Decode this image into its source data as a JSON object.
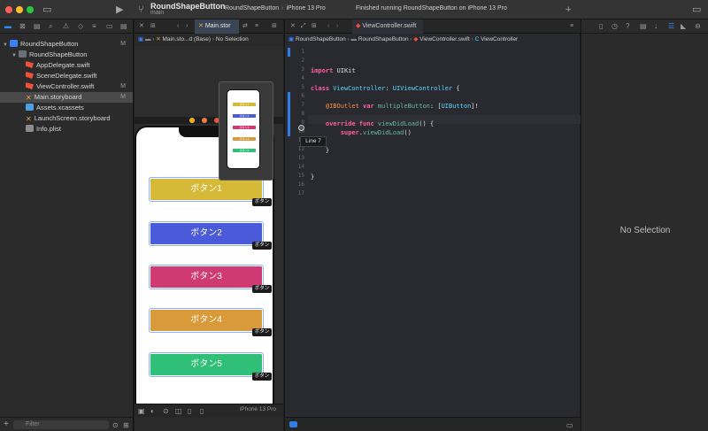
{
  "window": {
    "project_title": "RoundShapeButton",
    "branch": "main",
    "scheme": "RoundShapeButton",
    "device": "iPhone 13 Pro",
    "status": "Finished running RoundShapeButton on iPhone 13 Pro"
  },
  "navigator": {
    "items": [
      {
        "label": "RoundShapeButton",
        "mark": "M"
      },
      {
        "label": "RoundShapeButton",
        "mark": ""
      },
      {
        "label": "AppDelegate.swift",
        "mark": ""
      },
      {
        "label": "SceneDelegate.swift",
        "mark": ""
      },
      {
        "label": "ViewController.swift",
        "mark": "M"
      },
      {
        "label": "Main.storyboard",
        "mark": "M"
      },
      {
        "label": "Assets.xcassets",
        "mark": ""
      },
      {
        "label": "LaunchScreen.storyboard",
        "mark": ""
      },
      {
        "label": "Info.plist",
        "mark": ""
      }
    ],
    "filter_placeholder": "Filter"
  },
  "storyboard_editor": {
    "tab_label": "Main.stor",
    "breadcrumb": [
      "Main.sto...d (Base)",
      "No Selection"
    ],
    "buttons": [
      {
        "label": "ボタン1",
        "color": "#d6b937"
      },
      {
        "label": "ボタン2",
        "color": "#4a5ad9"
      },
      {
        "label": "ボタン3",
        "color": "#d03a72"
      },
      {
        "label": "ボタン4",
        "color": "#d99a3a"
      },
      {
        "label": "ボタン5",
        "color": "#2fbf77"
      }
    ],
    "badge_label": "ボタン",
    "preview_labels": [
      "ボタン1",
      "ボタン2",
      "ボタン3",
      "ボタン4",
      "ボタン5"
    ],
    "device_label": "iPhone 13 Pro"
  },
  "code_editor": {
    "tab_label": "ViewController.swift",
    "breadcrumb": [
      "RoundShapeButton",
      "RoundShapeButton",
      "ViewController.swift",
      "ViewController"
    ],
    "line_numbers": [
      "1",
      "2",
      "3",
      "4",
      "5",
      "6",
      "7",
      "8",
      "9",
      "10",
      "11",
      "12",
      "13",
      "14",
      "15",
      "16",
      "17"
    ],
    "tooltip": "Line 7"
  },
  "inspector": {
    "no_selection": "No Selection"
  }
}
